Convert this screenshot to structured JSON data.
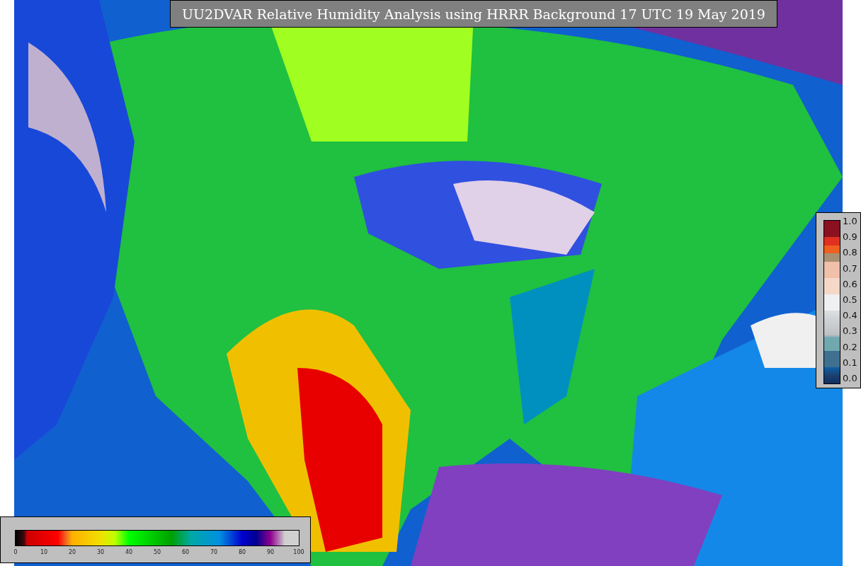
{
  "title": "UU2DVAR Relative Humidity Analysis using HRRR Background 17 UTC 19 May 2019",
  "humidity_colorbar": {
    "ticks": [
      "0",
      "10",
      "20",
      "30",
      "40",
      "50",
      "60",
      "70",
      "80",
      "90",
      "100"
    ]
  },
  "weight_colorbar": {
    "ticks": [
      "1.0",
      "0.9",
      "0.8",
      "0.7",
      "0.6",
      "0.5",
      "0.4",
      "0.3",
      "0.2",
      "0.1",
      "0.0"
    ]
  }
}
